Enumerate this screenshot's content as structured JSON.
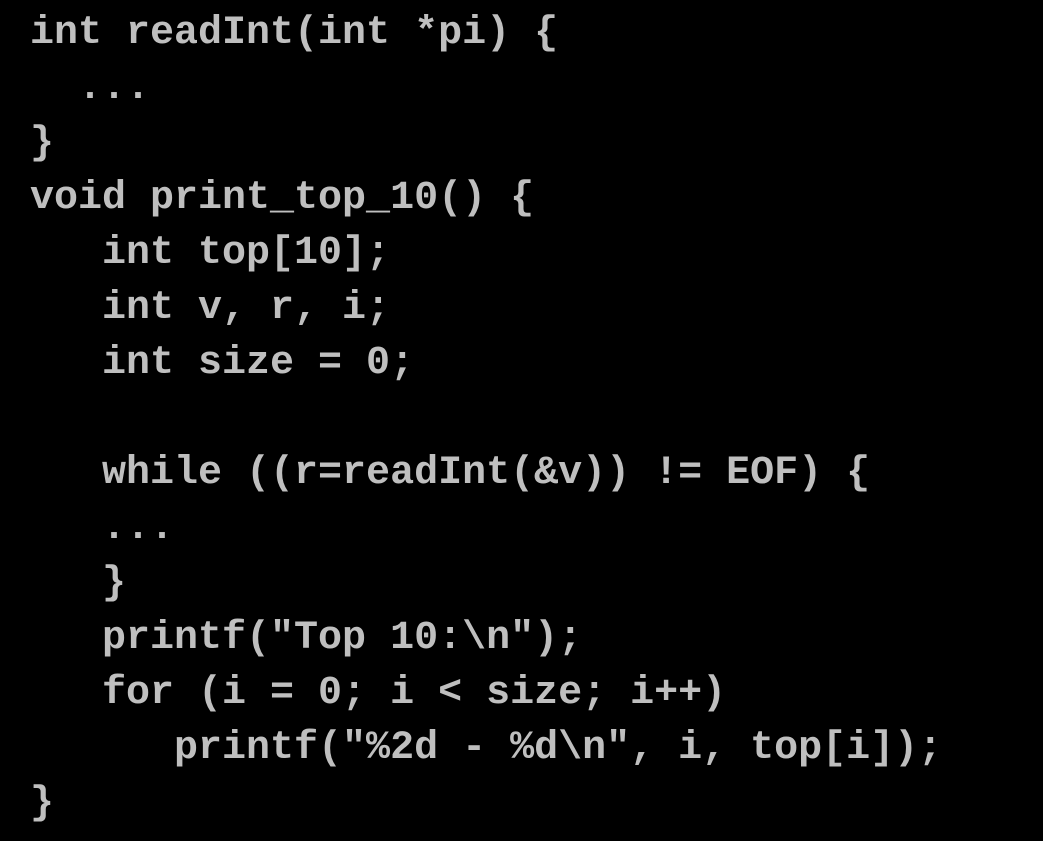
{
  "code": {
    "lines": [
      " int readInt(int *pi) {",
      "   ...",
      " }",
      " void print_top_10() {",
      "    int top[10];",
      "    int v, r, i;",
      "    int size = 0;",
      "",
      "    while ((r=readInt(&v)) != EOF) {",
      "    ...",
      "    }",
      "    printf(\"Top 10:\\n\");",
      "    for (i = 0; i < size; i++)",
      "       printf(\"%2d - %d\\n\", i, top[i]);",
      " }"
    ]
  }
}
